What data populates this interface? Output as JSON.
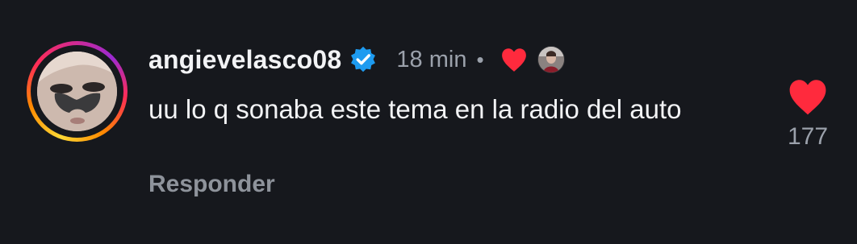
{
  "comment": {
    "username": "angievelasco08",
    "time": "18 min",
    "separator": "•",
    "text": "uu lo q sonaba este tema en la radio del auto",
    "reply_label": "Responder",
    "like_count": "177",
    "icons": {
      "verified": "verified-badge-icon",
      "creator_like": "heart-icon",
      "like": "heart-icon"
    },
    "colors": {
      "background": "#16181d",
      "heart": "#ff2a3d",
      "verified": "#1d9bf0",
      "muted_text": "#9ba1ab"
    }
  }
}
